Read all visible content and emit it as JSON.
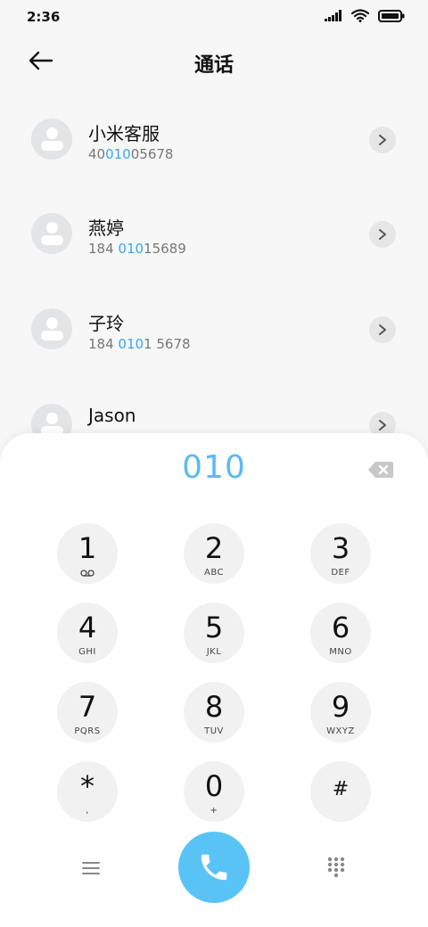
{
  "status_bar": {
    "time": "2:36",
    "icons": [
      "signal-icon",
      "wifi-icon",
      "battery-icon"
    ]
  },
  "header": {
    "title": "通话",
    "back_icon": "back-arrow-icon"
  },
  "contacts": [
    {
      "name": "小米客服",
      "number_parts": [
        "40",
        "010",
        "05678"
      ]
    },
    {
      "name": "燕婷",
      "number_parts": [
        "184 ",
        "010",
        "15689"
      ]
    },
    {
      "name": "子玲",
      "number_parts": [
        "184 ",
        "010",
        "1 5678"
      ]
    },
    {
      "name": "Jason",
      "number_parts": [
        "",
        "",
        ""
      ]
    }
  ],
  "dialer": {
    "input_value": "010",
    "keys": [
      {
        "digit": "1",
        "letters": "",
        "sub_icon": "voicemail-icon"
      },
      {
        "digit": "2",
        "letters": "ABC"
      },
      {
        "digit": "3",
        "letters": "DEF"
      },
      {
        "digit": "4",
        "letters": "GHI"
      },
      {
        "digit": "5",
        "letters": "JKL"
      },
      {
        "digit": "6",
        "letters": "MNO"
      },
      {
        "digit": "7",
        "letters": "PQRS"
      },
      {
        "digit": "8",
        "letters": "TUV"
      },
      {
        "digit": "9",
        "letters": "WXYZ"
      },
      {
        "digit": "*",
        "letters": ","
      },
      {
        "digit": "0",
        "letters": "+"
      },
      {
        "digit": "#",
        "letters": ""
      }
    ]
  },
  "colors": {
    "accent": "#5bbbf0",
    "highlight": "#38a8e8",
    "call_button": "#5ac3f5"
  }
}
